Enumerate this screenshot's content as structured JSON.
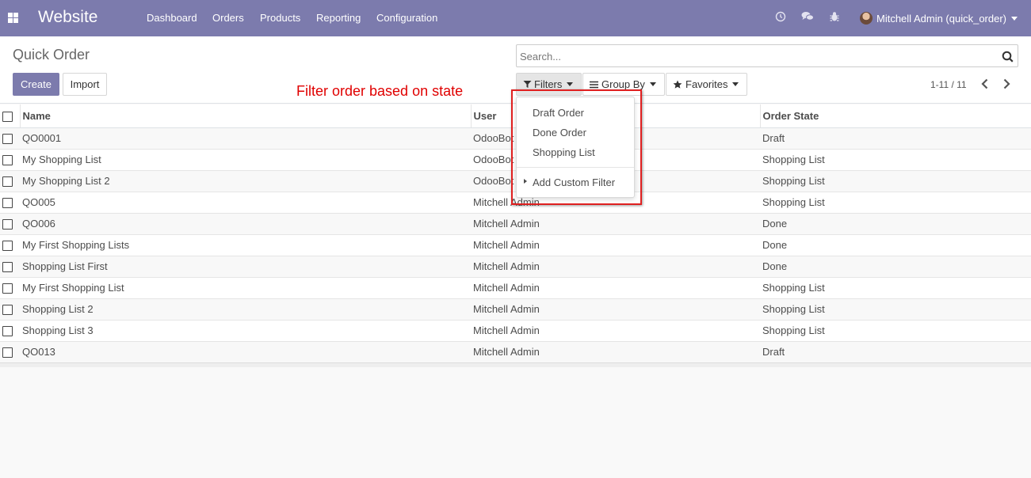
{
  "navbar": {
    "app_name": "Website",
    "menu": [
      "Dashboard",
      "Orders",
      "Products",
      "Reporting",
      "Configuration"
    ],
    "user_name": "Mitchell Admin (quick_order)",
    "color": "#7c7bad"
  },
  "page": {
    "title": "Quick Order",
    "create_label": "Create",
    "import_label": "Import"
  },
  "search": {
    "placeholder": "Search..."
  },
  "filters": {
    "filters_label": "Filters",
    "groupby_label": "Group By",
    "favorites_label": "Favorites"
  },
  "pager": {
    "text": "1-11 / 11"
  },
  "table": {
    "headers": [
      "Name",
      "User",
      "Order State"
    ],
    "rows": [
      {
        "name": "QO0001",
        "user": "OdooBot",
        "state": "Draft"
      },
      {
        "name": "My Shopping List",
        "user": "OdooBot",
        "state": "Shopping List"
      },
      {
        "name": "My Shopping List 2",
        "user": "OdooBot",
        "state": "Shopping List"
      },
      {
        "name": "QO005",
        "user": "Mitchell Admin",
        "state": "Shopping List"
      },
      {
        "name": "QO006",
        "user": "Mitchell Admin",
        "state": "Done"
      },
      {
        "name": "My First Shopping Lists",
        "user": "Mitchell Admin",
        "state": "Done"
      },
      {
        "name": "Shopping List First",
        "user": "Mitchell Admin",
        "state": "Done"
      },
      {
        "name": "My First Shopping List",
        "user": "Mitchell Admin",
        "state": "Shopping List"
      },
      {
        "name": "Shopping List 2",
        "user": "Mitchell Admin",
        "state": "Shopping List"
      },
      {
        "name": "Shopping List 3",
        "user": "Mitchell Admin",
        "state": "Shopping List"
      },
      {
        "name": "QO013",
        "user": "Mitchell Admin",
        "state": "Draft"
      }
    ]
  },
  "filter_dropdown": {
    "items": [
      "Draft Order",
      "Done Order",
      "Shopping List"
    ],
    "custom": "Add Custom Filter"
  },
  "annotation": {
    "text": "Filter order based on state",
    "color": "#e00000"
  }
}
